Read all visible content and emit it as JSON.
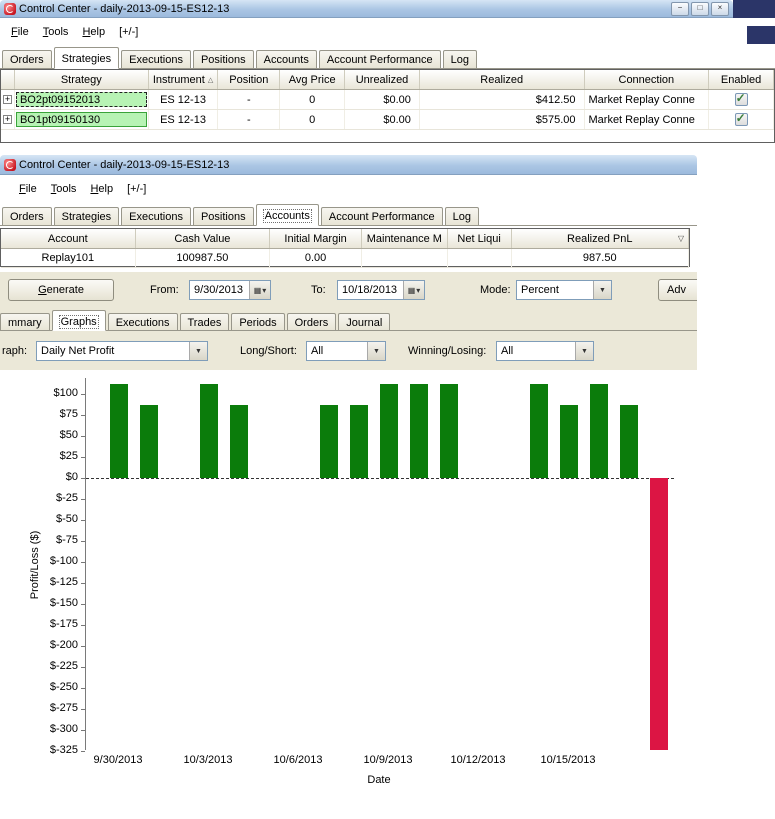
{
  "backdrop_color": "#2b3568",
  "icons": {
    "dropdown": "▼",
    "dropdown_small": "▾",
    "calendar": "▦",
    "check": "✓",
    "sort_asc": "△",
    "sort_desc": "▽"
  },
  "window1": {
    "title": "Control Center - daily-2013-09-15-ES12-13",
    "buttons": {
      "minimize": "−",
      "maximize": "□",
      "close": "×"
    },
    "menu": [
      {
        "key": "F",
        "rest": "ile"
      },
      {
        "key": "T",
        "rest": "ools"
      },
      {
        "key": "H",
        "rest": "elp"
      },
      {
        "key": "",
        "rest": "[+/-]"
      }
    ],
    "tabs": [
      "Orders",
      "Strategies",
      "Executions",
      "Positions",
      "Accounts",
      "Account Performance",
      "Log"
    ],
    "selected_tab": "Strategies",
    "grid": {
      "headers": [
        "Strategy",
        "Instrument",
        "Position",
        "Avg Price",
        "Unrealized",
        "Realized",
        "Connection",
        "Enabled"
      ],
      "rows": [
        {
          "expander": "+",
          "strategy": "BO2pt09152013",
          "instrument": "ES 12-13",
          "position": "-",
          "avg_price": "0",
          "unrealized": "$0.00",
          "realized": "$412.50",
          "connection": "Market Replay Conne",
          "enabled": true
        },
        {
          "expander": "+",
          "strategy": "BO1pt09150130",
          "instrument": "ES 12-13",
          "position": "-",
          "avg_price": "0",
          "unrealized": "$0.00",
          "realized": "$575.00",
          "connection": "Market Replay Conne",
          "enabled": true
        }
      ]
    }
  },
  "window2": {
    "title": "Control Center - daily-2013-09-15-ES12-13",
    "menu": [
      {
        "key": "F",
        "rest": "ile"
      },
      {
        "key": "T",
        "rest": "ools"
      },
      {
        "key": "H",
        "rest": "elp"
      },
      {
        "key": "",
        "rest": "[+/-]"
      }
    ],
    "tabs": [
      "Orders",
      "Strategies",
      "Executions",
      "Positions",
      "Accounts",
      "Account Performance",
      "Log"
    ],
    "selected_tab": "Accounts",
    "grid": {
      "headers": [
        "Account",
        "Cash Value",
        "Initial Margin",
        "Maintenance M",
        "Net Liqui",
        "Realized PnL"
      ],
      "rows": [
        [
          "Replay101",
          "100987.50",
          "0.00",
          "",
          "",
          "987.50"
        ]
      ]
    },
    "toolbar": {
      "generate": {
        "key": "G",
        "rest": "enerate"
      },
      "from_label": "From:",
      "from_value": "9/30/2013",
      "to_label": "To:",
      "to_value": "10/18/2013",
      "mode_label": "Mode:",
      "mode_value": "Percent",
      "advanced_label": "Adv"
    },
    "subtabs": [
      "mmary",
      "Graphs",
      "Executions",
      "Trades",
      "Periods",
      "Orders",
      "Journal"
    ],
    "selected_subtab": "Graphs",
    "graph_controls": {
      "graph_label": "raph:",
      "graph_value": "Daily Net Profit",
      "longshort_label": "Long/Short:",
      "longshort_value": "All",
      "winlose_label": "Winning/Losing:",
      "winlose_value": "All"
    }
  },
  "chart_data": {
    "type": "bar",
    "title": "",
    "ylabel": "Profit/Loss ($)",
    "xlabel": "Date",
    "ylim": [
      -325,
      112.5
    ],
    "grid": false,
    "zero_line": "dashed",
    "bar_colors": {
      "positive": "#0b7c0b",
      "negative": "#dc1544"
    },
    "ytick_labels": [
      "$100",
      "$75",
      "$50",
      "$25",
      "$0",
      "$-25",
      "$-50",
      "$-75",
      "$-100",
      "$-125",
      "$-150",
      "$-175",
      "$-200",
      "$-225",
      "$-250",
      "$-275",
      "$-300",
      "$-325"
    ],
    "ytick_values": [
      100,
      75,
      50,
      25,
      0,
      -25,
      -50,
      -75,
      -100,
      -125,
      -150,
      -175,
      -200,
      -225,
      -250,
      -275,
      -300,
      -325
    ],
    "xtick_labels": [
      "9/30/2013",
      "10/3/2013",
      "10/6/2013",
      "10/9/2013",
      "10/12/2013",
      "10/15/2013"
    ],
    "xtick_day_offsets": [
      0,
      3,
      6,
      9,
      12,
      15
    ],
    "bars": [
      {
        "date": "9/30/2013",
        "day": 0,
        "value": 112.5
      },
      {
        "date": "10/1/2013",
        "day": 1,
        "value": 87.5
      },
      {
        "date": "10/3/2013",
        "day": 3,
        "value": 112.5
      },
      {
        "date": "10/4/2013",
        "day": 4,
        "value": 87.5
      },
      {
        "date": "10/7/2013",
        "day": 7,
        "value": 87.5
      },
      {
        "date": "10/8/2013",
        "day": 8,
        "value": 87.5
      },
      {
        "date": "10/9/2013",
        "day": 9,
        "value": 112.5
      },
      {
        "date": "10/10/2013",
        "day": 10,
        "value": 112.5
      },
      {
        "date": "10/11/2013",
        "day": 11,
        "value": 112.5
      },
      {
        "date": "10/14/2013",
        "day": 14,
        "value": 112.5
      },
      {
        "date": "10/15/2013",
        "day": 15,
        "value": 87.5
      },
      {
        "date": "10/16/2013",
        "day": 16,
        "value": 112.5
      },
      {
        "date": "10/17/2013",
        "day": 17,
        "value": 87.5
      },
      {
        "date": "10/18/2013",
        "day": 18,
        "value": -325
      }
    ]
  }
}
